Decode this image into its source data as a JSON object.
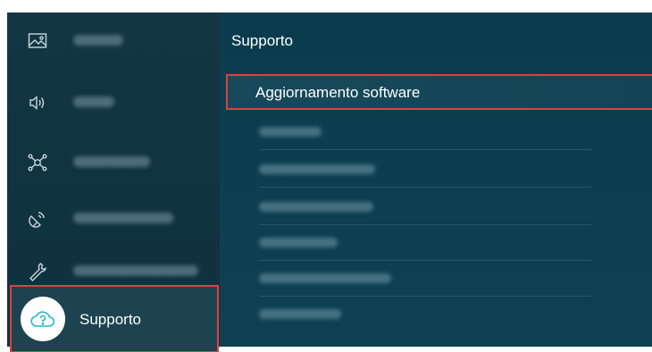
{
  "left_menu": {
    "items": [
      {
        "icon": "picture-icon",
        "label_visible": false
      },
      {
        "icon": "sound-icon",
        "label_visible": false
      },
      {
        "icon": "connection-icon",
        "label_visible": false
      },
      {
        "icon": "broadcasting-icon",
        "label_visible": false
      },
      {
        "icon": "general-privacy-icon",
        "label_visible": false
      }
    ],
    "selected": {
      "icon": "support-icon",
      "label": "Supporto"
    }
  },
  "right_panel": {
    "title": "Supporto",
    "focused_item": "Aggiornamento software",
    "blurred_items_count": 6
  },
  "colors": {
    "left_bg": "#123643",
    "right_bg": "#0b3c4d",
    "highlight_border": "#e0403c",
    "text": "#ffffff"
  }
}
